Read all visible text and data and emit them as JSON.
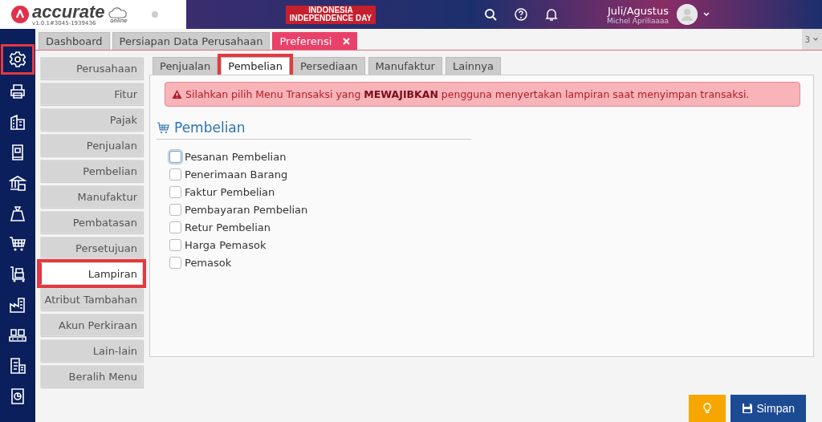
{
  "header": {
    "logo_text": "accurate",
    "logo_sub": "online",
    "version": "v1.0.1#3045-1939436",
    "banner_lines": [
      "INDONESIA",
      "INDEPENDENCE DAY"
    ],
    "user": {
      "period": "Juli/Agustus",
      "name": "Michel Apriliaaaa"
    }
  },
  "tabs": [
    {
      "label": "Dashboard",
      "selected": false,
      "closable": false
    },
    {
      "label": "Persiapan Data Perusahaan",
      "selected": false,
      "closable": false
    },
    {
      "label": "Preferensi",
      "selected": true,
      "closable": true
    }
  ],
  "tab_count": "3",
  "nav_icons": [
    {
      "kind": "gear",
      "highlighted": true
    },
    {
      "kind": "printer",
      "highlighted": false
    },
    {
      "kind": "building",
      "highlighted": false
    },
    {
      "kind": "book",
      "highlighted": false
    },
    {
      "kind": "bank",
      "highlighted": false
    },
    {
      "kind": "bag",
      "highlighted": false
    },
    {
      "kind": "cart",
      "highlighted": false
    },
    {
      "kind": "trolley",
      "highlighted": false
    },
    {
      "kind": "factory",
      "highlighted": false
    },
    {
      "kind": "conveyor",
      "highlighted": false
    },
    {
      "kind": "tax",
      "highlighted": false
    },
    {
      "kind": "report",
      "highlighted": false
    }
  ],
  "settings_menu": [
    {
      "label": "Perusahaan",
      "selected": false,
      "highlighted": false
    },
    {
      "label": "Fitur",
      "selected": false,
      "highlighted": false
    },
    {
      "label": "Pajak",
      "selected": false,
      "highlighted": false
    },
    {
      "label": "Penjualan",
      "selected": false,
      "highlighted": false
    },
    {
      "label": "Pembelian",
      "selected": false,
      "highlighted": false
    },
    {
      "label": "Manufaktur",
      "selected": false,
      "highlighted": false
    },
    {
      "label": "Pembatasan",
      "selected": false,
      "highlighted": false
    },
    {
      "label": "Persetujuan",
      "selected": false,
      "highlighted": false
    },
    {
      "label": "Lampiran",
      "selected": true,
      "highlighted": true
    },
    {
      "label": "Atribut Tambahan",
      "selected": false,
      "highlighted": false
    },
    {
      "label": "Akun Perkiraan",
      "selected": false,
      "highlighted": false
    },
    {
      "label": "Lain-lain",
      "selected": false,
      "highlighted": false
    },
    {
      "label": "Beralih Menu",
      "selected": false,
      "highlighted": false
    }
  ],
  "subtabs": [
    {
      "label": "Penjualan",
      "selected": false,
      "highlighted": false
    },
    {
      "label": "Pembelian",
      "selected": true,
      "highlighted": true
    },
    {
      "label": "Persediaan",
      "selected": false,
      "highlighted": false
    },
    {
      "label": "Manufaktur",
      "selected": false,
      "highlighted": false
    },
    {
      "label": "Lainnya",
      "selected": false,
      "highlighted": false
    }
  ],
  "alert": "Silahkan pilih Menu Transaksi yang **MEWAJIBKAN** pengguna menyertakan lampiran saat menyimpan transaksi.",
  "section_title": "Pembelian",
  "checkboxes": [
    {
      "label": "Pesanan Pembelian",
      "checked": false,
      "focused": true
    },
    {
      "label": "Penerimaan Barang",
      "checked": false,
      "focused": false
    },
    {
      "label": "Faktur Pembelian",
      "checked": false,
      "focused": false
    },
    {
      "label": "Pembayaran Pembelian",
      "checked": false,
      "focused": false
    },
    {
      "label": "Retur Pembelian",
      "checked": false,
      "focused": false
    },
    {
      "label": "Harga Pemasok",
      "checked": false,
      "focused": false
    },
    {
      "label": "Pemasok",
      "checked": false,
      "focused": false
    }
  ],
  "save_button": "Simpan"
}
